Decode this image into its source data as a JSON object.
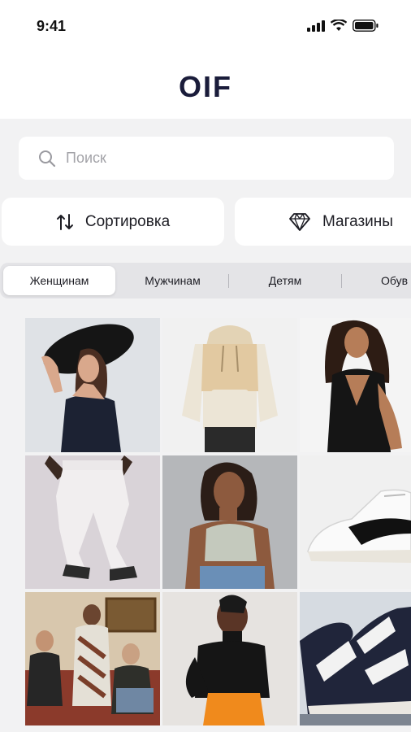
{
  "status_bar": {
    "time": "9:41"
  },
  "header": {
    "logo": "OIF"
  },
  "search": {
    "placeholder": "Поиск"
  },
  "actions": {
    "sort_label": "Сортировка",
    "shops_label": "Магазины"
  },
  "tabs": [
    {
      "label": "Женщинам",
      "active": true
    },
    {
      "label": "Мужчинам",
      "active": false
    },
    {
      "label": "Детям",
      "active": false
    },
    {
      "label": "Обув",
      "active": false
    }
  ],
  "colors": {
    "logo": "#1a1c3a",
    "background": "#f2f2f3",
    "accent": "#1d1d24"
  },
  "products": [
    {
      "name": "woman-black-hat-image"
    },
    {
      "name": "beige-hoodie-image"
    },
    {
      "name": "black-dress-image"
    },
    {
      "name": "white-trousers-image"
    },
    {
      "name": "crop-top-image"
    },
    {
      "name": "white-sneaker-image"
    },
    {
      "name": "group-photo-image"
    },
    {
      "name": "black-turtleneck-image"
    },
    {
      "name": "high-top-sneaker-image"
    }
  ]
}
